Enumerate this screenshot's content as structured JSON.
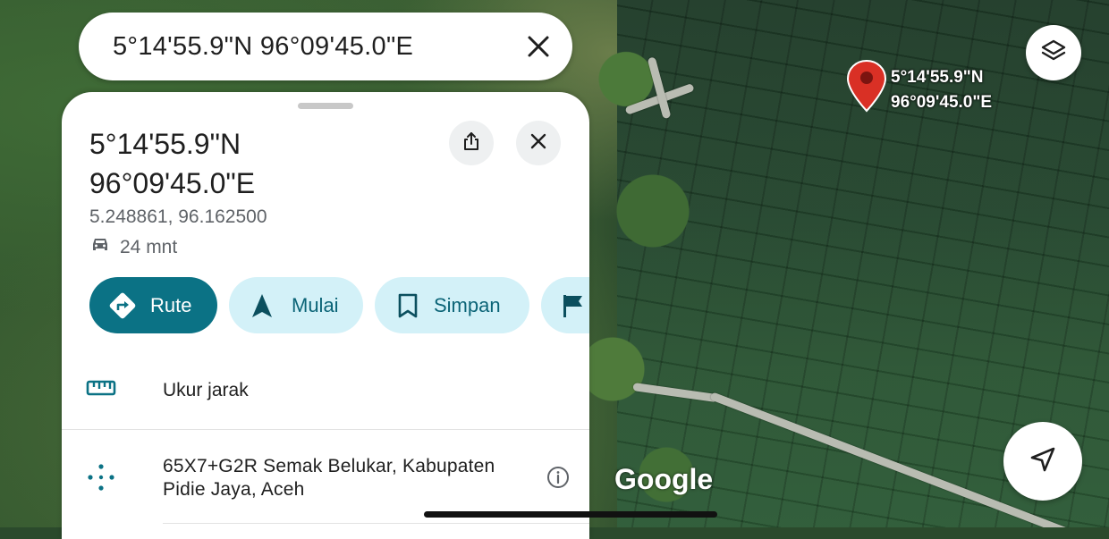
{
  "search": {
    "query": "5°14'55.9\"N 96°09'45.0\"E"
  },
  "map": {
    "pin_label_line1": "5°14'55.9\"N",
    "pin_label_line2": "96°09'45.0\"E",
    "attribution": "Google",
    "pin_color": "#d93025"
  },
  "place": {
    "title_line1": "5°14'55.9\"N",
    "title_line2": "96°09'45.0\"E",
    "decimal_coords": "5.248861, 96.162500",
    "drive_time": "24 mnt"
  },
  "actions": [
    {
      "label": "Rute",
      "icon": "directions-icon",
      "style": "primary"
    },
    {
      "label": "Mulai",
      "icon": "navigation-arrow-icon",
      "style": "secondary"
    },
    {
      "label": "Simpan",
      "icon": "bookmark-icon",
      "style": "secondary"
    },
    {
      "label": "",
      "icon": "flag-icon",
      "style": "secondary"
    }
  ],
  "list": {
    "measure_label": "Ukur jarak",
    "plus_code_line1": "65X7+G2R Semak Belukar, Kabupaten",
    "plus_code_line2": "Pidie Jaya, Aceh"
  },
  "colors": {
    "accent": "#0b7285",
    "chip_secondary_bg": "#d3f1f8"
  }
}
